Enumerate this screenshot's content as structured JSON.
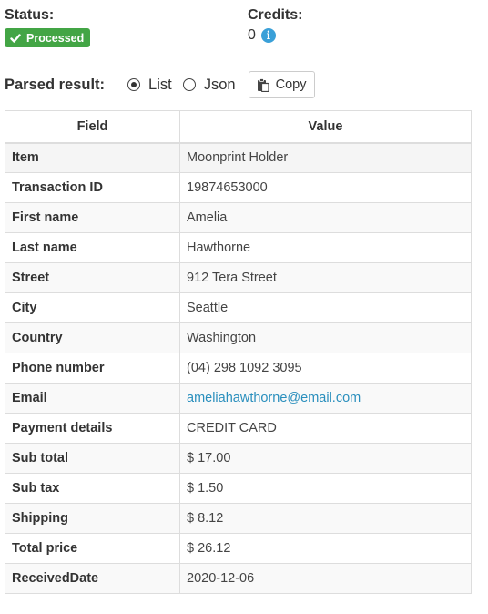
{
  "status": {
    "label": "Status:",
    "badge_text": "Processed",
    "badge_icon": "check-icon",
    "badge_color": "#43a545"
  },
  "credits": {
    "label": "Credits:",
    "value": "0",
    "info_icon": "info-icon"
  },
  "parsed": {
    "label": "Parsed result:",
    "options": [
      {
        "label": "List",
        "selected": true
      },
      {
        "label": "Json",
        "selected": false
      }
    ],
    "copy_label": "Copy",
    "copy_icon": "clipboard-icon"
  },
  "table": {
    "headers": [
      "Field",
      "Value"
    ],
    "rows": [
      {
        "field": "Item",
        "value": "Moonprint Holder"
      },
      {
        "field": "Transaction ID",
        "value": "19874653000"
      },
      {
        "field": "First name",
        "value": "Amelia"
      },
      {
        "field": "Last name",
        "value": "Hawthorne"
      },
      {
        "field": "Street",
        "value": "912 Tera Street"
      },
      {
        "field": "City",
        "value": "Seattle"
      },
      {
        "field": "Country",
        "value": "Washington"
      },
      {
        "field": "Phone number",
        "value": "(04) 298 1092 3095"
      },
      {
        "field": "Email",
        "value": "ameliahawthorne@email.com"
      },
      {
        "field": "Payment details",
        "value": "CREDIT CARD"
      },
      {
        "field": "Sub total",
        "value": "$ 17.00"
      },
      {
        "field": "Sub tax",
        "value": "$ 1.50"
      },
      {
        "field": "Shipping",
        "value": "$ 8.12"
      },
      {
        "field": "Total price",
        "value": "$ 26.12"
      },
      {
        "field": "ReceivedDate",
        "value": "2020-12-06"
      }
    ]
  },
  "colors": {
    "link": "#2a8fbd",
    "info": "#3aa0d8"
  }
}
